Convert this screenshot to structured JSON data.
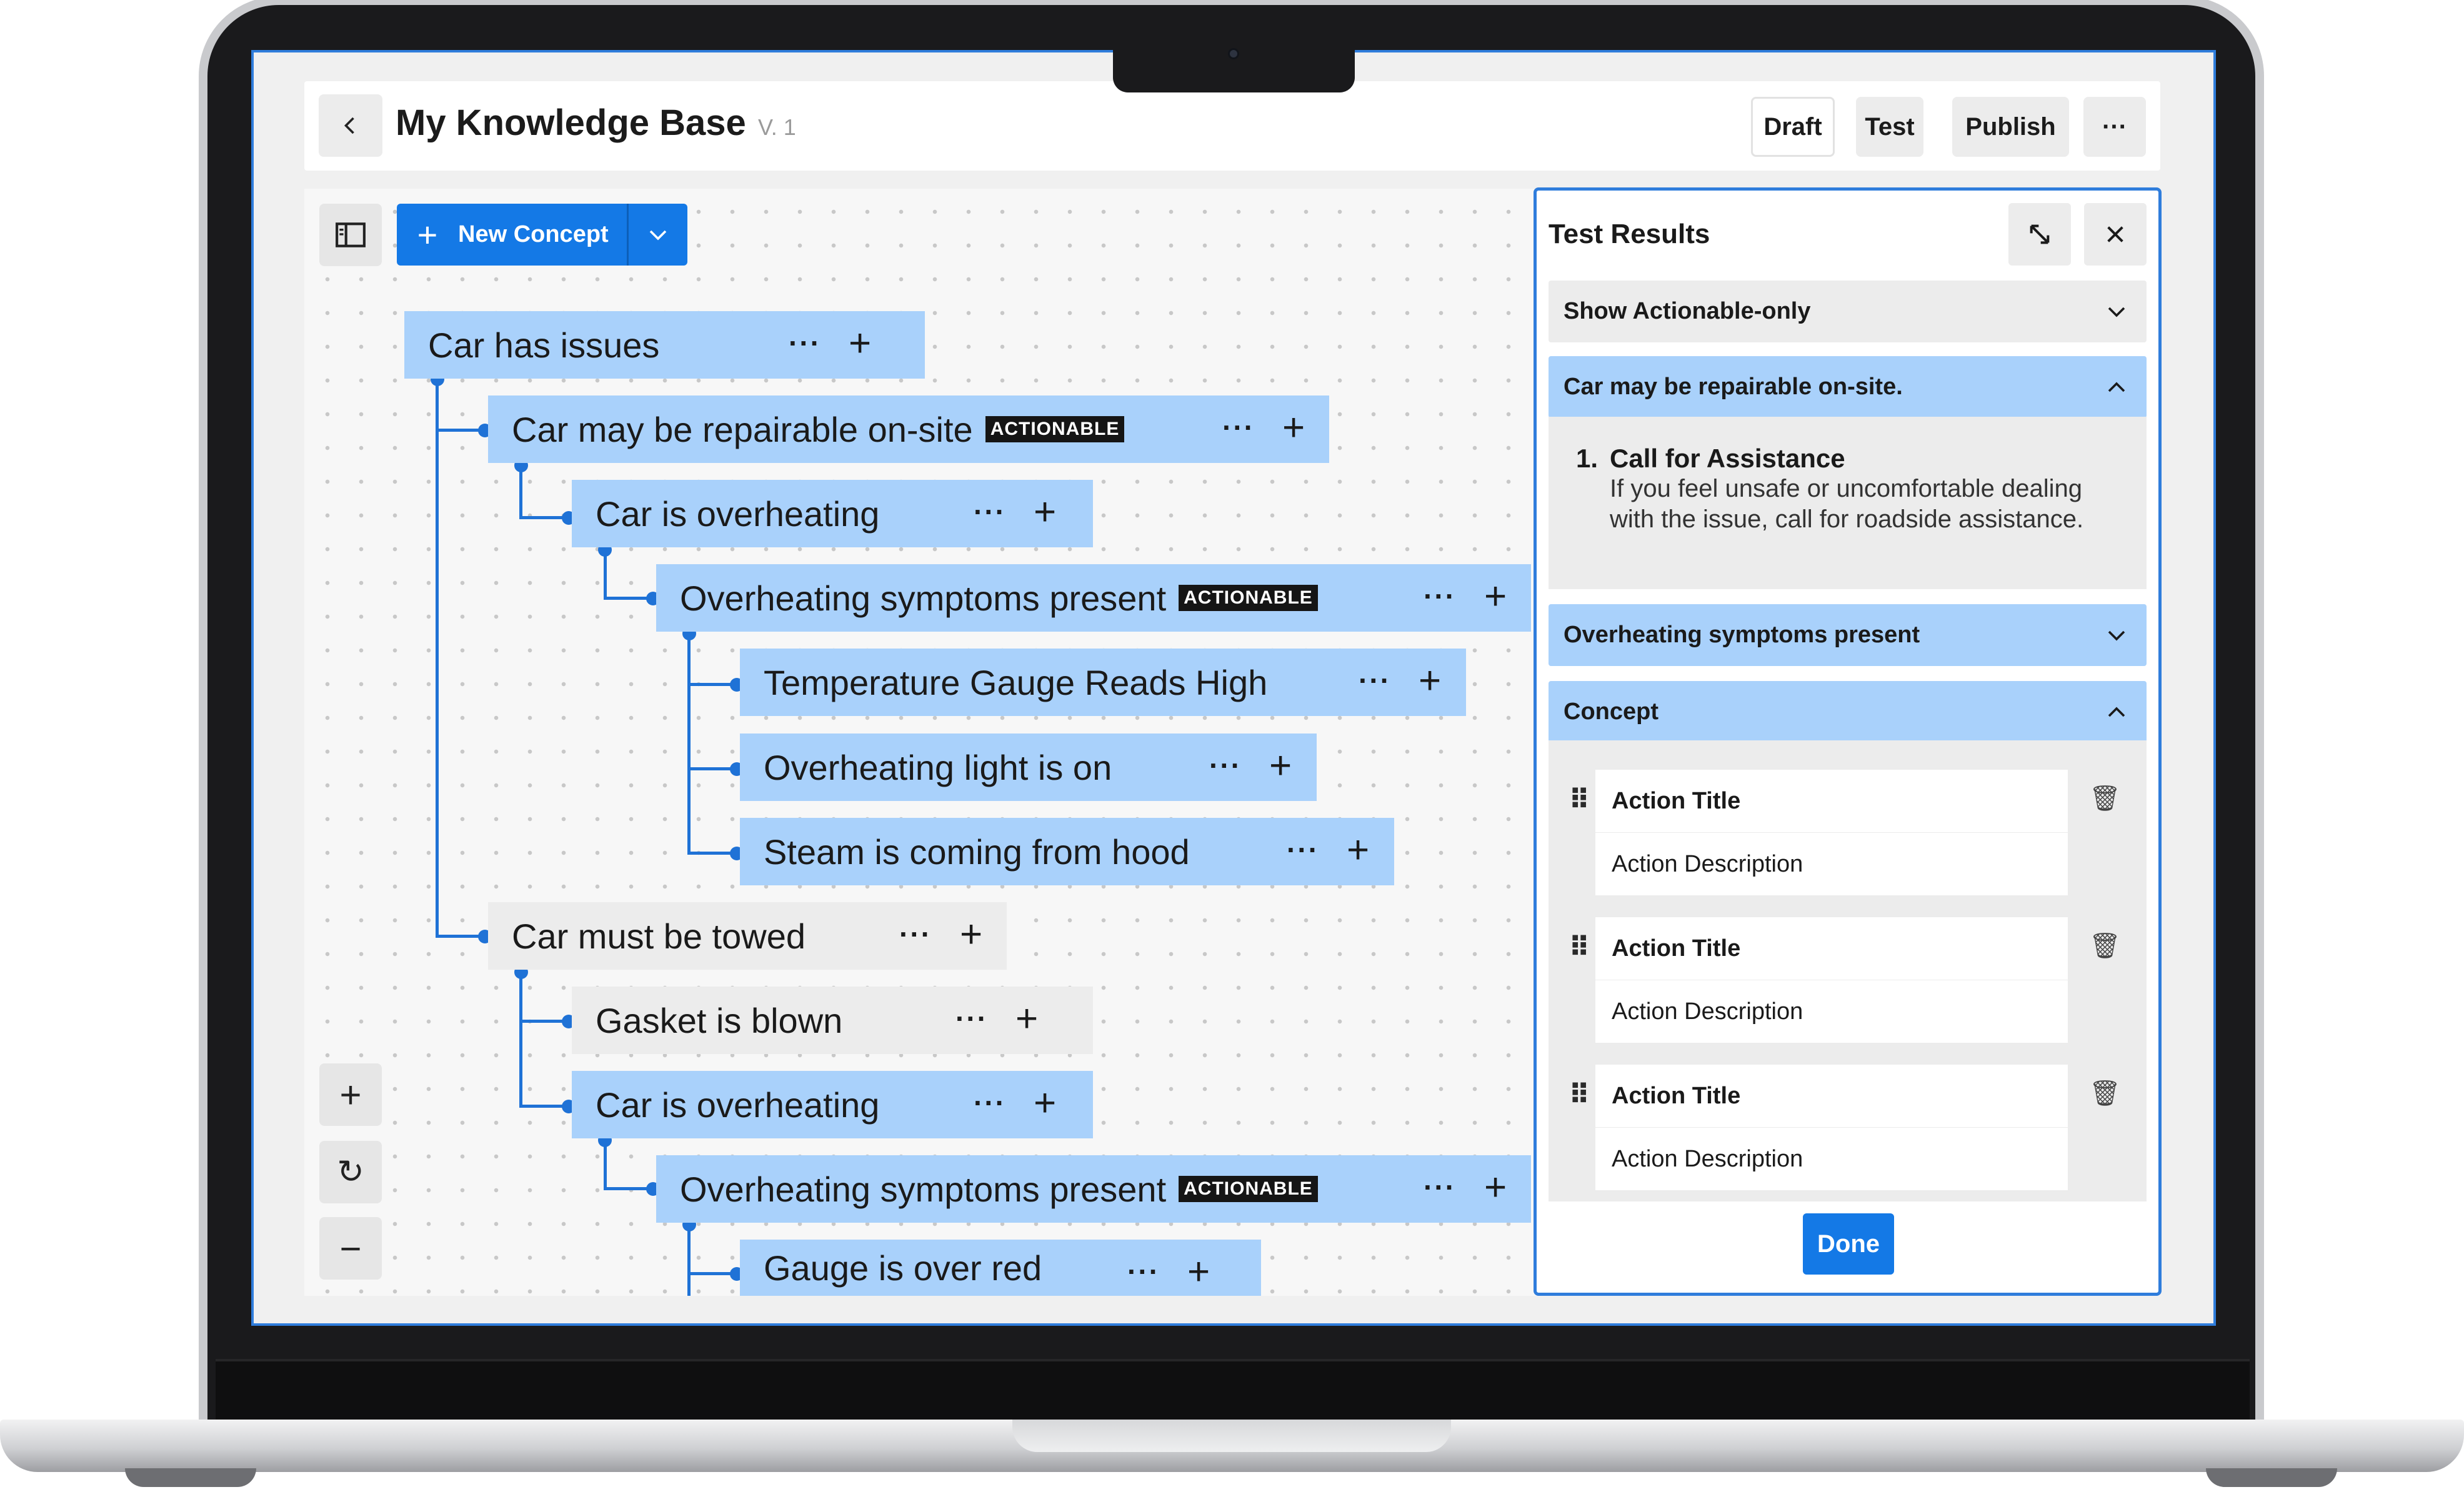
{
  "header": {
    "back_icon": "chevron-left-icon",
    "title": "My Knowledge Base",
    "version": "V. 1",
    "buttons": {
      "draft": "Draft",
      "test": "Test",
      "publish": "Publish",
      "more": "···"
    }
  },
  "toolbar": {
    "sidebar_toggle_icon": "sidebar-icon",
    "new_concept": {
      "plus": "+",
      "label": "New Concept",
      "dropdown_icon": "chevron-down-icon"
    }
  },
  "canvas_controls": {
    "zoom_in": "+",
    "reset": "↻",
    "zoom_out": "−"
  },
  "tree": {
    "badge": "ACTIONABLE",
    "more": "···",
    "add": "+",
    "nodes": [
      {
        "label": "Car has issues",
        "style": "blue"
      },
      {
        "label": "Car may be repairable on-site",
        "style": "blue",
        "actionable": true
      },
      {
        "label": "Car is overheating",
        "style": "blue"
      },
      {
        "label": "Overheating symptoms present",
        "style": "blue",
        "actionable": true
      },
      {
        "label": "Temperature Gauge Reads High",
        "style": "blue"
      },
      {
        "label": "Overheating light is on",
        "style": "blue"
      },
      {
        "label": "Steam is coming from hood",
        "style": "blue"
      },
      {
        "label": "Car must be towed",
        "style": "grey"
      },
      {
        "label": "Gasket is blown",
        "style": "grey"
      },
      {
        "label": "Car is overheating",
        "style": "blue"
      },
      {
        "label": "Overheating symptoms present",
        "style": "blue",
        "actionable": true
      },
      {
        "label": "Gauge is over red",
        "style": "blue"
      }
    ]
  },
  "panel": {
    "title": "Test Results",
    "expand_icon": "expand-icon",
    "close_icon": "close-icon",
    "filter": "Show Actionable-only",
    "section_repairable": {
      "title": "Car may be repairable on-site.",
      "step_number": "1.",
      "step_title": "Call for Assistance",
      "step_desc": "If you feel unsafe or uncomfortable dealing with the issue, call for roadside assistance."
    },
    "section_symptoms": "Overheating symptoms present",
    "section_concept": "Concept",
    "actions": [
      {
        "title": "Action Title",
        "description": "Action Description"
      },
      {
        "title": "Action Title",
        "description": "Action Description"
      },
      {
        "title": "Action Title",
        "description": "Action Description"
      }
    ],
    "done": "Done"
  },
  "colors": {
    "accent": "#1479e6",
    "node_blue": "#a9d1fb",
    "node_grey": "#ececec",
    "connector": "#1f72d6"
  }
}
